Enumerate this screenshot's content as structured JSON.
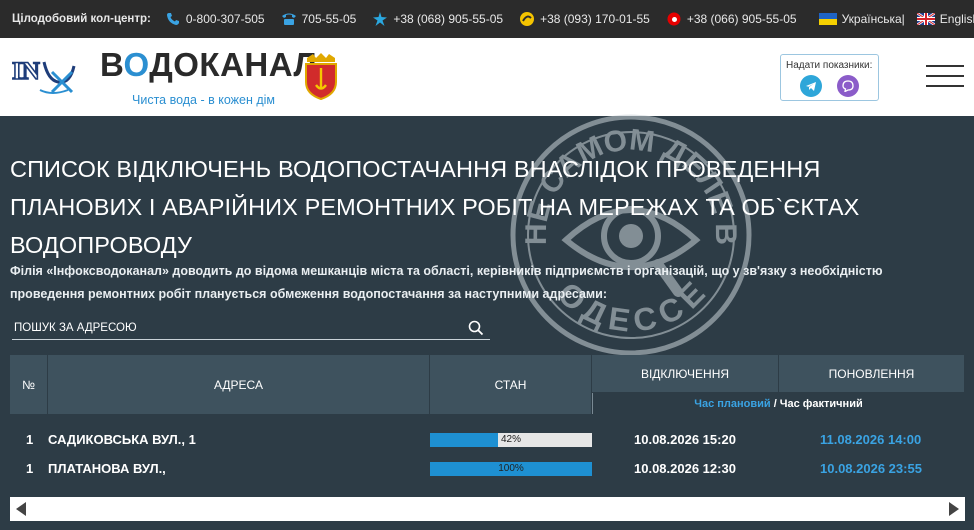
{
  "topbar": {
    "label": "Цілодобовий кол-центр:",
    "phones": [
      {
        "icon": "phone-icon",
        "text": "0-800-307-505"
      },
      {
        "icon": "landline-phone-icon",
        "text": "705-55-05"
      },
      {
        "icon": "kyivstar-icon",
        "text": "+38 (068) 905-55-05"
      },
      {
        "icon": "lifecell-icon",
        "text": "+38 (093) 170-01-55"
      },
      {
        "icon": "vodafone-icon",
        "text": "+38 (066) 905-55-05"
      }
    ],
    "lang_ua": "Українська|",
    "lang_en": "English"
  },
  "header": {
    "brand": "ВОДОКАНАЛ",
    "brand_first": "В",
    "brand_o": "О",
    "brand_rest": "ДОКАНАЛ",
    "slogan": "Чиста вода - в кожен дім",
    "meter_label": "Надати показники:"
  },
  "page": {
    "title": "СПИСОК ВІДКЛЮЧЕНЬ ВОДОПОСТАЧАННЯ ВНАСЛІДОК ПРОВЕДЕННЯ ПЛАНОВИХ І АВАРІЙНИХ РЕМОНТНИХ РОБІТ НА МЕРЕЖАХ ТА ОБ`ЄКТАХ ВОДОПРОВОДУ",
    "intro": "Філія «Інфоксводоканал» доводить до відома мешканців міста та області, керівників підприємств і організацій, що у зв'язку з необхідністю проведення ремонтних робіт планується обмеження водопостачання за наступними адресами:",
    "search_placeholder": "ПОШУК ЗА АДРЕСОЮ"
  },
  "table": {
    "headers": {
      "num": "№",
      "address": "АДРЕСА",
      "status": "СТАН",
      "off": "ВІДКЛЮЧЕННЯ",
      "update": "ПОНОВЛЕННЯ"
    },
    "time_planned": "Час плановий",
    "time_sep": "/",
    "time_actual": "Час фактичний",
    "rows": [
      {
        "num": "1",
        "address": "САДИКОВСЬКА ВУЛ., 1",
        "progress": 42,
        "progress_label": "42%",
        "off": "10.08.2026 15:20",
        "update": "11.08.2026 14:00"
      },
      {
        "num": "1",
        "address": "ПЛАТАНОВА ВУЛ.,",
        "progress": 100,
        "progress_label": "100%",
        "off": "10.08.2026 12:30",
        "update": "10.08.2026 23:55"
      }
    ]
  },
  "stamp": {
    "top_text": "НЕ САМОМ ДЕЛЕ В",
    "bottom_text": "ОДЕССЕ"
  },
  "colors": {
    "background": "#2d3c46",
    "accent": "#2b8fd1",
    "progress": "#1e90d2",
    "link": "#3aa3e3"
  }
}
